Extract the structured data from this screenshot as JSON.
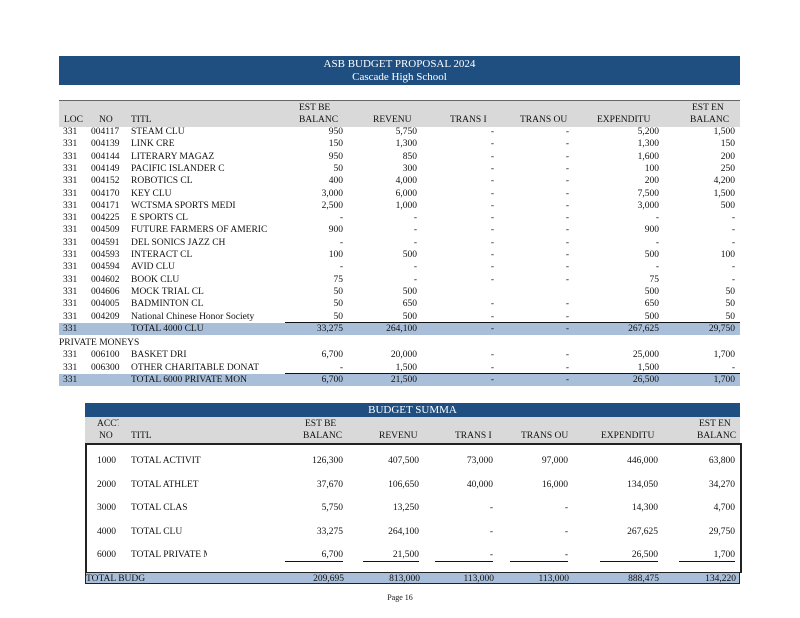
{
  "title": {
    "line1": "ASB BUDGET PROPOSAL 2024",
    "line2": "Cascade High School"
  },
  "columns": {
    "loc": "LOC",
    "no": "NO",
    "title": "TITL",
    "est_begin_top": "EST BE",
    "est_begin_bottom": "BALANC",
    "revenue": "REVENU",
    "trans_in": "TRANS I",
    "trans_out": "TRANS OU",
    "expenditure": "EXPENDITU",
    "est_end_top": "EST EN",
    "est_end_bottom": "BALANC"
  },
  "clubs": [
    {
      "loc": "331",
      "no": "004117",
      "title": "STEAM CLU",
      "begin": "950",
      "rev": "5,750",
      "tin": "-",
      "tout": "-",
      "exp": "5,200",
      "end": "1,500"
    },
    {
      "loc": "331",
      "no": "004139",
      "title": "LINK CRE",
      "begin": "150",
      "rev": "1,300",
      "tin": "-",
      "tout": "-",
      "exp": "1,300",
      "end": "150"
    },
    {
      "loc": "331",
      "no": "004144",
      "title": "LITERARY MAGAZ",
      "begin": "950",
      "rev": "850",
      "tin": "-",
      "tout": "-",
      "exp": "1,600",
      "end": "200"
    },
    {
      "loc": "331",
      "no": "004149",
      "title": "PACIFIC ISLANDER C",
      "begin": "50",
      "rev": "300",
      "tin": "-",
      "tout": "-",
      "exp": "100",
      "end": "250"
    },
    {
      "loc": "331",
      "no": "004152",
      "title": "ROBOTICS CL",
      "begin": "400",
      "rev": "4,000",
      "tin": "-",
      "tout": "-",
      "exp": "200",
      "end": "4,200"
    },
    {
      "loc": "331",
      "no": "004170",
      "title": "KEY CLU",
      "begin": "3,000",
      "rev": "6,000",
      "tin": "-",
      "tout": "-",
      "exp": "7,500",
      "end": "1,500"
    },
    {
      "loc": "331",
      "no": "004171",
      "title": "WCTSMA SPORTS MEDI",
      "begin": "2,500",
      "rev": "1,000",
      "tin": "-",
      "tout": "-",
      "exp": "3,000",
      "end": "500"
    },
    {
      "loc": "331",
      "no": "004225",
      "title": "E SPORTS CL",
      "begin": "-",
      "rev": "-",
      "tin": "-",
      "tout": "-",
      "exp": "-",
      "end": "-"
    },
    {
      "loc": "331",
      "no": "004509",
      "title": "FUTURE FARMERS OF AMERIC",
      "begin": "900",
      "rev": "-",
      "tin": "-",
      "tout": "-",
      "exp": "900",
      "end": "-"
    },
    {
      "loc": "331",
      "no": "004591",
      "title": "DEL SONICS JAZZ CH",
      "begin": "-",
      "rev": "-",
      "tin": "-",
      "tout": "-",
      "exp": "-",
      "end": "-"
    },
    {
      "loc": "331",
      "no": "004593",
      "title": "INTERACT CL",
      "begin": "100",
      "rev": "500",
      "tin": "-",
      "tout": "-",
      "exp": "500",
      "end": "100"
    },
    {
      "loc": "331",
      "no": "004594",
      "title": "AVID CLU",
      "begin": "-",
      "rev": "-",
      "tin": "-",
      "tout": "-",
      "exp": "-",
      "end": "-"
    },
    {
      "loc": "331",
      "no": "004602",
      "title": "BOOK CLU",
      "begin": "75",
      "rev": "-",
      "tin": "-",
      "tout": "-",
      "exp": "75",
      "end": "-"
    },
    {
      "loc": "331",
      "no": "004606",
      "title": "MOCK TRIAL CL",
      "begin": "50",
      "rev": "500",
      "tin": "",
      "tout": "",
      "exp": "500",
      "end": "50"
    },
    {
      "loc": "331",
      "no": "004005",
      "title": "BADMINTON CL",
      "begin": "50",
      "rev": "650",
      "tin": "-",
      "tout": "-",
      "exp": "650",
      "end": "50"
    },
    {
      "loc": "331",
      "no": "004209",
      "title": "National Chinese Honor Society",
      "begin": "50",
      "rev": "500",
      "tin": "-",
      "tout": "-",
      "exp": "500",
      "end": "50"
    }
  ],
  "clubs_total": {
    "loc": "331",
    "title": "TOTAL 4000 CLU",
    "begin": "33,275",
    "rev": "264,100",
    "tin": "-",
    "tout": "-",
    "exp": "267,625",
    "end": "29,750"
  },
  "private_label": "PRIVATE MONEYS",
  "private": [
    {
      "loc": "331",
      "no": "006100",
      "title": "BASKET DRI",
      "begin": "6,700",
      "rev": "20,000",
      "tin": "-",
      "tout": "-",
      "exp": "25,000",
      "end": "1,700"
    },
    {
      "loc": "331",
      "no": "006300",
      "title": "OTHER CHARITABLE DONAT",
      "begin": "-",
      "rev": "1,500",
      "tin": "-",
      "tout": "-",
      "exp": "1,500",
      "end": "-"
    }
  ],
  "private_total": {
    "loc": "331",
    "title": "TOTAL 6000 PRIVATE MON",
    "begin": "6,700",
    "rev": "21,500",
    "tin": "-",
    "tout": "-",
    "exp": "26,500",
    "end": "1,700"
  },
  "summary": {
    "title": "BUDGET SUMMA",
    "hdr_acct_top": "ACCT",
    "hdr_acct_bottom": "NO",
    "hdr_title": "TITL",
    "hdr_begin_top": "EST BE",
    "hdr_begin_bottom": "BALANC",
    "hdr_rev": "REVENU",
    "hdr_tin": "TRANS I",
    "hdr_tout": "TRANS OU",
    "hdr_exp": "EXPENDITU",
    "hdr_end_top": "EST EN",
    "hdr_end_bottom": "BALANC",
    "rows": [
      {
        "no": "1000",
        "title": "TOTAL ACTIVIT",
        "begin": "126,300",
        "rev": "407,500",
        "tin": "73,000",
        "tout": "97,000",
        "exp": "446,000",
        "end": "63,800"
      },
      {
        "no": "2000",
        "title": "TOTAL ATHLET",
        "begin": "37,670",
        "rev": "106,650",
        "tin": "40,000",
        "tout": "16,000",
        "exp": "134,050",
        "end": "34,270"
      },
      {
        "no": "3000",
        "title": "TOTAL CLAS",
        "begin": "5,750",
        "rev": "13,250",
        "tin": "-",
        "tout": "-",
        "exp": "14,300",
        "end": "4,700"
      },
      {
        "no": "4000",
        "title": "TOTAL CLU",
        "begin": "33,275",
        "rev": "264,100",
        "tin": "-",
        "tout": "-",
        "exp": "267,625",
        "end": "29,750"
      },
      {
        "no": "6000",
        "title": "TOTAL PRIVATE MON",
        "begin": "6,700",
        "rev": "21,500",
        "tin": "-",
        "tout": "-",
        "exp": "26,500",
        "end": "1,700"
      }
    ],
    "total": {
      "title": "TOTAL BUDG",
      "begin": "209,695",
      "rev": "813,000",
      "tin": "113,000",
      "tout": "113,000",
      "exp": "888,475",
      "end": "134,220"
    }
  },
  "footer": "Page 16"
}
